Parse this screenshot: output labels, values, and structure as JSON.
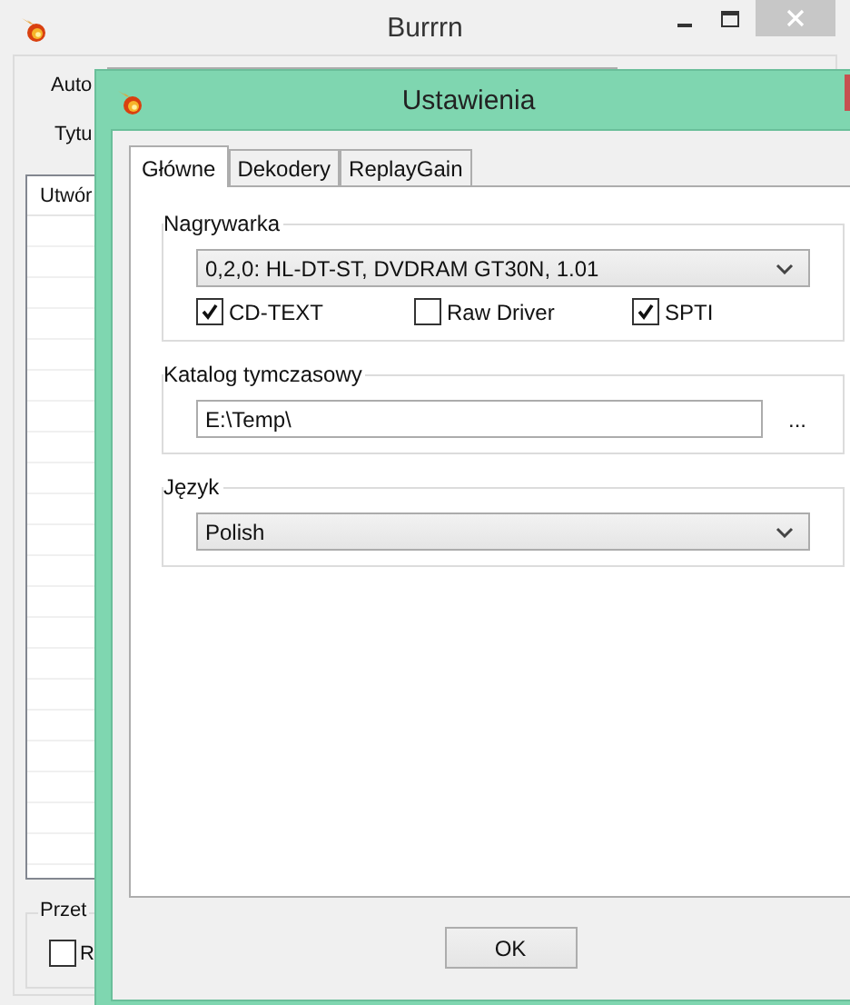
{
  "main_window": {
    "title": "Burrrn",
    "labels": [
      "Auto",
      "Tytu"
    ],
    "list": {
      "columns": [
        "Utwór"
      ]
    },
    "group": {
      "title": "Przet",
      "checkbox": {
        "label": "R",
        "checked": false
      }
    }
  },
  "dialog": {
    "title": "Ustawienia",
    "tabs": [
      {
        "label": "Główne",
        "selected": true
      },
      {
        "label": "Dekodery",
        "selected": false
      },
      {
        "label": "ReplayGain",
        "selected": false
      }
    ],
    "groups": [
      {
        "kind": "drive",
        "title": "Nagrywarka",
        "select": "0,2,0: HL-DT-ST, DVDRAM GT30N, 1.01",
        "checkboxes": [
          {
            "label": "CD-TEXT",
            "checked": true
          },
          {
            "label": "Raw Driver",
            "checked": false
          },
          {
            "label": "SPTI",
            "checked": true
          }
        ]
      },
      {
        "kind": "path",
        "title": "Katalog tymczasowy",
        "value": "E:\\Temp\\",
        "browse": "..."
      },
      {
        "kind": "select",
        "title": "Język",
        "select": "Polish"
      }
    ],
    "buttons": [
      "OK"
    ]
  }
}
